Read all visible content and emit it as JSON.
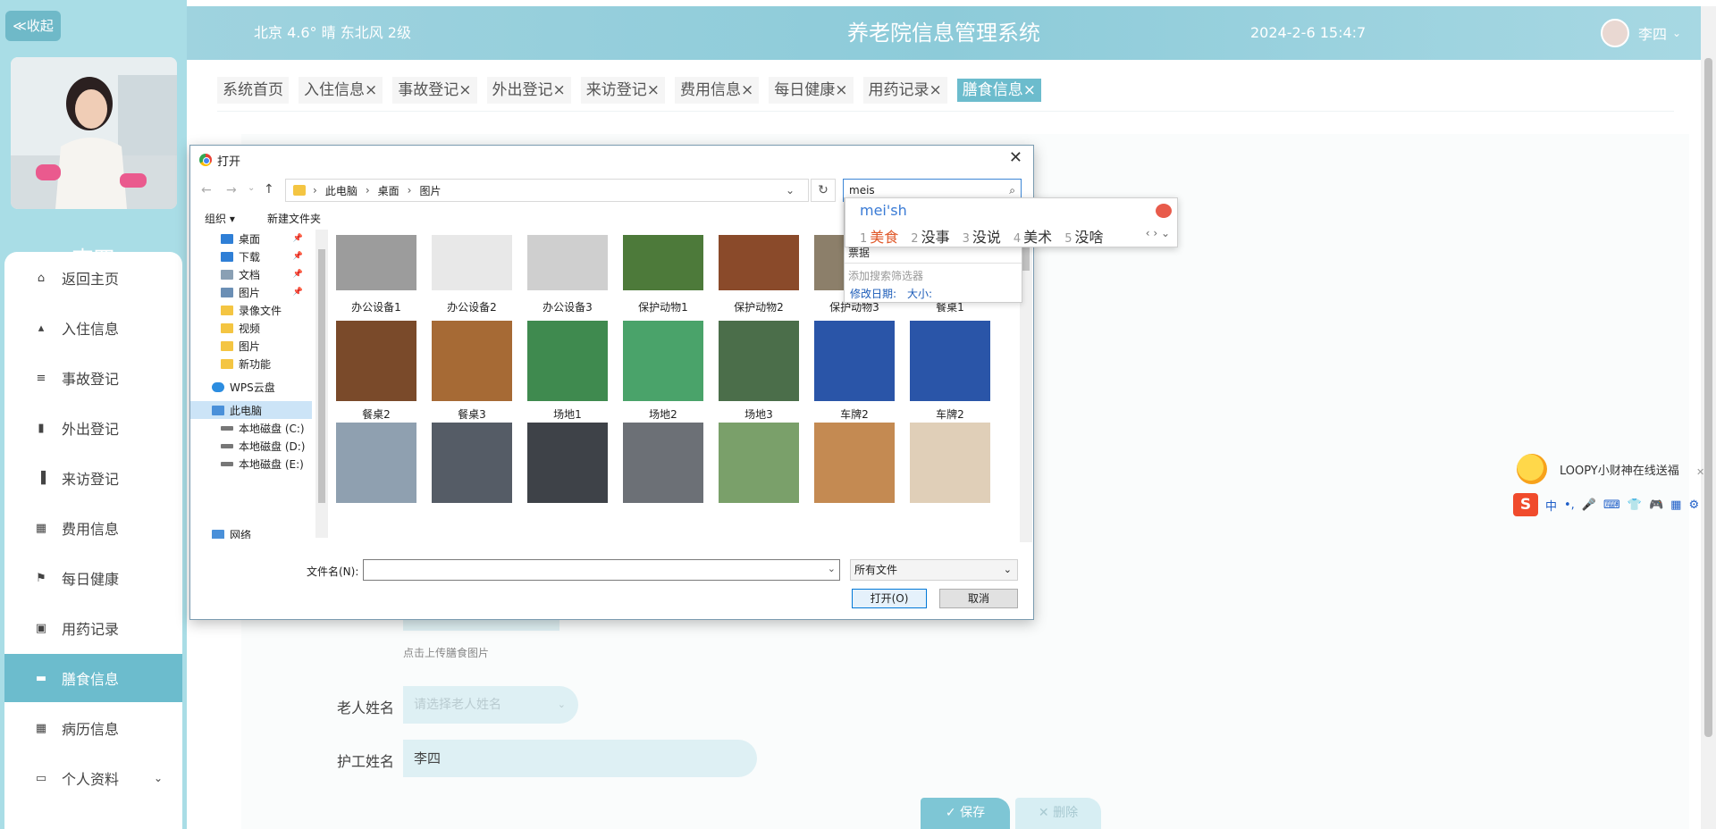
{
  "sidebar": {
    "collapse_label": "≪收起",
    "user_name": "李四",
    "menu": [
      {
        "icon": "home-icon",
        "glyph": "⌂",
        "label": "返回主页"
      },
      {
        "icon": "person-icon",
        "glyph": "▴",
        "label": "入住信息"
      },
      {
        "icon": "list-icon",
        "glyph": "≡",
        "label": "事故登记"
      },
      {
        "icon": "clipboard-icon",
        "glyph": "▮",
        "label": "外出登记"
      },
      {
        "icon": "bar-chart-icon",
        "glyph": "▐",
        "label": "来访登记"
      },
      {
        "icon": "grid-icon",
        "glyph": "▦",
        "label": "费用信息"
      },
      {
        "icon": "flag-icon",
        "glyph": "⚑",
        "label": "每日健康"
      },
      {
        "icon": "medicine-icon",
        "glyph": "▣",
        "label": "用药记录"
      },
      {
        "icon": "food-icon",
        "glyph": "▬",
        "label": "膳食信息"
      },
      {
        "icon": "grid-icon",
        "glyph": "▦",
        "label": "病历信息"
      },
      {
        "icon": "profile-card-icon",
        "glyph": "▭",
        "label": "个人资料"
      }
    ]
  },
  "header": {
    "weather": "北京 4.6° 晴 东北风 2级",
    "title": "养老院信息管理系统",
    "datetime": "2024-2-6 15:4:7",
    "user": "李四"
  },
  "tabs": [
    "系统首页",
    "入住信息×",
    "事故登记×",
    "外出登记×",
    "来访登记×",
    "费用信息×",
    "每日健康×",
    "用药记录×",
    "膳食信息×"
  ],
  "form": {
    "upload_tip": "点击上传膳食图片",
    "elder_label": "老人姓名",
    "elder_placeholder": "请选择老人姓名",
    "nurse_label": "护工姓名",
    "nurse_value": "李四",
    "save_label": "✓ 保存",
    "delete_label": "✕ 删除"
  },
  "dialog": {
    "title": "打开",
    "breadcrumb": [
      "此电脑",
      "桌面",
      "图片"
    ],
    "search_value": "meis",
    "organize_label": "组织 ▾",
    "new_folder_label": "新建文件夹",
    "tree": [
      {
        "label": "桌面",
        "color": "#2f7fd6",
        "pin": true
      },
      {
        "label": "下载",
        "color": "#2f7fd6",
        "pin": true
      },
      {
        "label": "文档",
        "color": "#8aa0b4",
        "pin": true
      },
      {
        "label": "图片",
        "color": "#6b8fb5",
        "pin": true
      },
      {
        "label": "录像文件",
        "color": "#f4c542",
        "pin": false
      },
      {
        "label": "视频",
        "color": "#f4c542",
        "pin": false
      },
      {
        "label": "图片",
        "color": "#f4c542",
        "pin": false
      },
      {
        "label": "新功能",
        "color": "#f4c542",
        "pin": false
      },
      {
        "label": "WPS云盘",
        "color": "#2c8de0",
        "pin": false
      },
      {
        "label": "此电脑",
        "color": "#4a90d9",
        "pin": false
      },
      {
        "label": "本地磁盘 (C:)",
        "color": "#777",
        "pin": false
      },
      {
        "label": "本地磁盘 (D:)",
        "color": "#777",
        "pin": false
      },
      {
        "label": "本地磁盘 (E:)",
        "color": "#777",
        "pin": false
      },
      {
        "label": "网络",
        "color": "#4a90d9",
        "pin": false
      }
    ],
    "files": [
      {
        "name": "办公设备1",
        "color": "#9c9c9c"
      },
      {
        "name": "办公设备2",
        "color": "#e8e8e8"
      },
      {
        "name": "办公设备3",
        "color": "#cfcfcf"
      },
      {
        "name": "保护动物1",
        "color": "#4d7a3a"
      },
      {
        "name": "保护动物2",
        "color": "#8a4a2a"
      },
      {
        "name": "保护动物3",
        "color": "#8c7f6a"
      },
      {
        "name": "餐桌1",
        "color": "#b89a72"
      },
      {
        "name": "餐桌2",
        "color": "#7a4a2a"
      },
      {
        "name": "餐桌3",
        "color": "#a66a35"
      },
      {
        "name": "场地1",
        "color": "#3f8a4f"
      },
      {
        "name": "场地2",
        "color": "#4aa36a"
      },
      {
        "name": "场地3",
        "color": "#4b6e4a"
      },
      {
        "name": "车牌2",
        "color": "#2a55a8"
      },
      {
        "name": "车牌2",
        "color": "#2a55a8"
      },
      {
        "name": "",
        "color": "#8fa0b0"
      },
      {
        "name": "",
        "color": "#555c66"
      },
      {
        "name": "",
        "color": "#3e4248"
      },
      {
        "name": "",
        "color": "#6c7076"
      },
      {
        "name": "",
        "color": "#7aa06a"
      },
      {
        "name": "",
        "color": "#c48a52"
      },
      {
        "name": "",
        "color": "#e0cfb8"
      }
    ],
    "filename_label": "文件名(N):",
    "filter_value": "所有文件",
    "open_label": "打开(O)",
    "cancel_label": "取消",
    "search_dropdown": {
      "item": "票据",
      "add_filter": "添加搜索筛选器",
      "modified": "修改日期:",
      "size": "大小:"
    }
  },
  "ime": {
    "pinyin": "mei'sh",
    "candidates": [
      {
        "n": "1",
        "text": "美食"
      },
      {
        "n": "2",
        "text": "没事"
      },
      {
        "n": "3",
        "text": "没说"
      },
      {
        "n": "4",
        "text": "美术"
      },
      {
        "n": "5",
        "text": "没啥"
      }
    ],
    "nav": "‹ › ⌄"
  },
  "promo": {
    "text": "LOOPY小财神在线送福"
  },
  "imebar": {
    "logo": "S",
    "items": [
      "中",
      "•,",
      "🎤",
      "⌨",
      "👕",
      "🎮",
      "▦",
      "⚙"
    ]
  }
}
